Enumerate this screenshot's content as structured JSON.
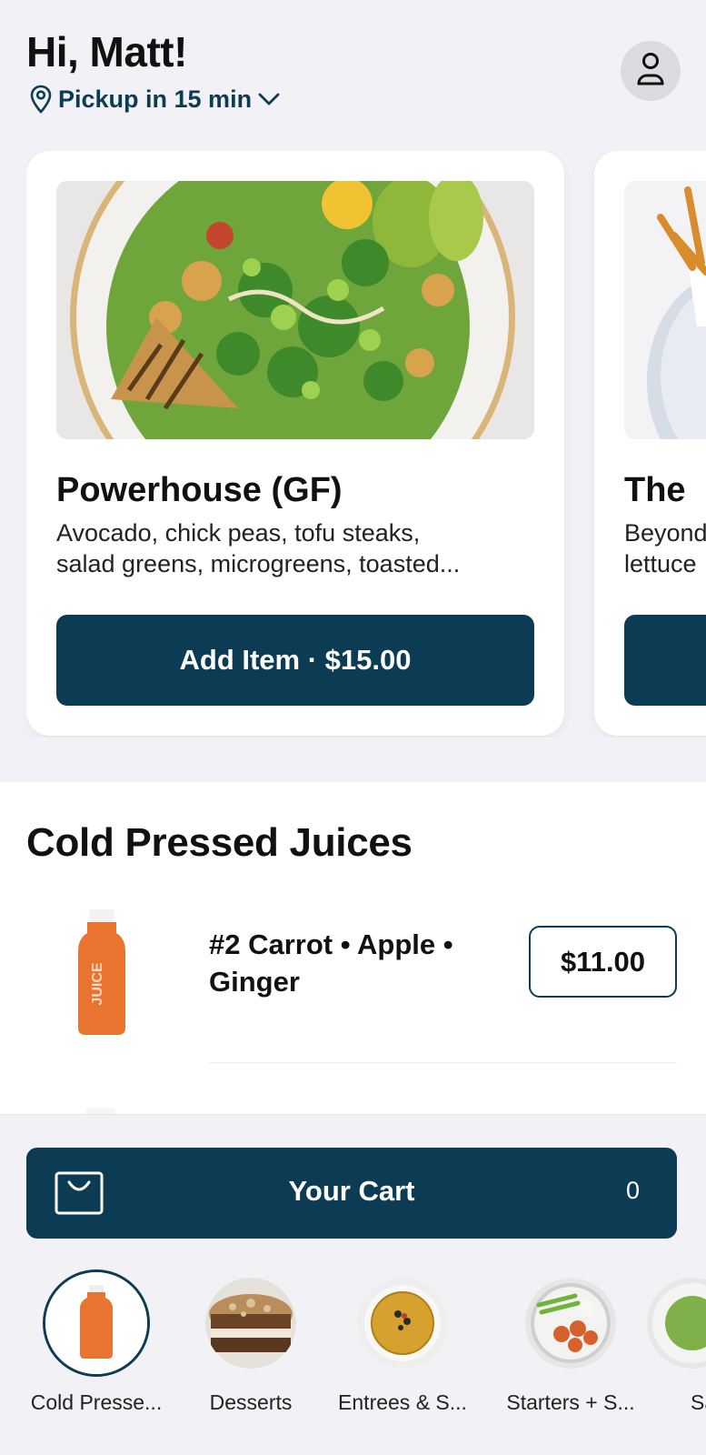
{
  "header": {
    "greeting": "Hi, Matt!",
    "pickup": "Pickup in 15 min",
    "icons": {
      "location": "location-pin-icon",
      "dropdown": "chevron-down-icon",
      "profile": "user-icon"
    }
  },
  "featured": [
    {
      "title": "Powerhouse (GF)",
      "description": "Avocado, chick peas, tofu steaks,\nsalad greens, microgreens, toasted...",
      "button": "Add Item · $15.00"
    },
    {
      "title": "The",
      "description": "Beyond\nlettuce"
    }
  ],
  "section": {
    "title": "Cold Pressed Juices",
    "items": [
      {
        "name": "#2 Carrot • Apple • Ginger",
        "price": "$11.00",
        "bottle_text": "JUICE"
      }
    ]
  },
  "cart": {
    "label": "Your Cart",
    "count": "0",
    "icon": "shopping-bag-icon"
  },
  "categories": [
    {
      "label": "Cold Presse...",
      "selected": true
    },
    {
      "label": "Desserts",
      "selected": false
    },
    {
      "label": "Entrees & S...",
      "selected": false
    },
    {
      "label": "Starters + S...",
      "selected": false
    },
    {
      "label": "Sa",
      "selected": false
    }
  ],
  "colors": {
    "primary": "#0b3c53",
    "background": "#f2f1f5",
    "card": "#ffffff"
  }
}
